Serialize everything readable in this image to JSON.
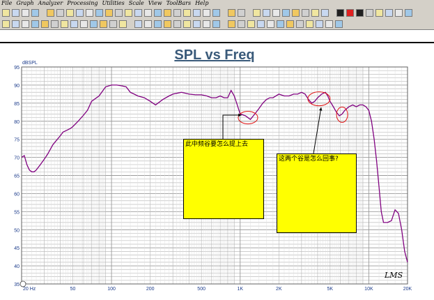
{
  "menu": {
    "items": [
      "File",
      "Graph",
      "Analyzer",
      "Processing",
      "Utilities",
      "Scale",
      "View",
      "ToolBars",
      "Help"
    ]
  },
  "toolbar": {
    "row1_icons": [
      "open-icon",
      "save-icon",
      "print-icon",
      "page-icon",
      "folder-icon",
      "folder-icon",
      "folder-icon",
      "folder-icon",
      "folder-icon",
      "folder-icon",
      "folder-icon",
      "folder-icon",
      "disk-icon",
      "disk-icon",
      "disk-icon",
      "disk-icon",
      "disk-icon",
      "disk-icon",
      "disk-icon",
      "disk-icon",
      "disk-icon",
      "disk-icon",
      "grid-icon",
      "grid-icon",
      "lasso-icon",
      "cursor-icon",
      "crop-icon",
      "crop-icon",
      "move-icon",
      "box-icon",
      "box-icon",
      "box-icon",
      "stop-icon",
      "record-icon",
      "stop-icon",
      "play-icon",
      "wand-icon",
      "tool-icon",
      "gear-icon",
      "mic-icon"
    ],
    "row2_icons": [
      "open-icon",
      "save-icon",
      "print-icon",
      "disk-icon",
      "disk-icon",
      "disk-icon",
      "disk-icon",
      "disk-icon",
      "disk-icon",
      "disk-icon",
      "disk-icon",
      "disk-icon",
      "disk-icon",
      "window-icon",
      "window-icon",
      "window-icon",
      "window-icon",
      "window-icon",
      "window-icon",
      "window-icon",
      "window-icon",
      "window-icon",
      "window-icon",
      "window-icon",
      "window-icon",
      "window-icon",
      "window-icon",
      "window-icon",
      "window-icon",
      "window-icon",
      "window-icon",
      "window-icon",
      "window-icon",
      "window-icon"
    ]
  },
  "chart_data": {
    "type": "line",
    "title": "SPL vs Freq",
    "ylabel": "dBSPL",
    "xlabel": "",
    "xscale": "log",
    "xlim": [
      20,
      20000
    ],
    "ylim": [
      35,
      95
    ],
    "grid": true,
    "legend": "none",
    "line_color": "#800080",
    "x_tick_labels": [
      {
        "value": 20,
        "label": "20 Hz"
      },
      {
        "value": 50,
        "label": "50"
      },
      {
        "value": 100,
        "label": "100"
      },
      {
        "value": 200,
        "label": "200"
      },
      {
        "value": 500,
        "label": "500"
      },
      {
        "value": 1000,
        "label": "1K"
      },
      {
        "value": 2000,
        "label": "2K"
      },
      {
        "value": 5000,
        "label": "5K"
      },
      {
        "value": 10000,
        "label": "10K"
      },
      {
        "value": 20000,
        "label": "20K"
      }
    ],
    "y_tick_labels": [
      "95",
      "90",
      "85",
      "80",
      "75",
      "70",
      "65",
      "60",
      "55",
      "50",
      "45",
      "40",
      "35"
    ],
    "series": [
      {
        "x": [
          20,
          21,
          22,
          23,
          24,
          25,
          26,
          28,
          30,
          32,
          35,
          40,
          42,
          45,
          48,
          50,
          55,
          60,
          65,
          70,
          80,
          90,
          100,
          105,
          110,
          120,
          130,
          140,
          150,
          160,
          180,
          200,
          220,
          250,
          280,
          300,
          350,
          400,
          450,
          500,
          550,
          600,
          650,
          700,
          750,
          800,
          850,
          900,
          950,
          1000,
          1100,
          1200,
          1300,
          1400,
          1500,
          1600,
          1700,
          1800,
          2000,
          2200,
          2400,
          2600,
          2800,
          3000,
          3200,
          3400,
          3600,
          3800,
          4000,
          4300,
          4600,
          4800,
          5000,
          5300,
          5600,
          5900,
          6200,
          6500,
          7000,
          7500,
          8000,
          8500,
          9000,
          9500,
          10000,
          10500,
          11000,
          11500,
          12000,
          12500,
          13000,
          14000,
          15000,
          16000,
          17000,
          18000,
          19000,
          20000
        ],
        "y": [
          70,
          70.5,
          68,
          66.5,
          66,
          66,
          66.5,
          68,
          69.5,
          71,
          73.5,
          76,
          77,
          77.5,
          78,
          78.5,
          80,
          81.5,
          83,
          85.5,
          87,
          89.5,
          90,
          90,
          90,
          89.8,
          89.5,
          88,
          87.5,
          87,
          86.5,
          85.5,
          84.5,
          86,
          87,
          87.5,
          88,
          87.5,
          87.3,
          87.3,
          87,
          86.5,
          86.5,
          87,
          86.5,
          86.5,
          88.5,
          87,
          84.5,
          82,
          81.5,
          80.5,
          82,
          83.5,
          85,
          86,
          86.5,
          86.5,
          87.5,
          87,
          87,
          87.5,
          87.5,
          88,
          87.5,
          86,
          85,
          85.5,
          86.5,
          87.5,
          88,
          87,
          85.5,
          84,
          82.5,
          81.5,
          82,
          83,
          84,
          84.5,
          84,
          84.5,
          84.5,
          84,
          83,
          80,
          75,
          69,
          62,
          55,
          52,
          52,
          52.5,
          55.5,
          54.5,
          50,
          44,
          41
        ]
      }
    ],
    "annotations": [
      {
        "text": "此中频谷要怎么提上去"
      },
      {
        "text": "这两个谷是怎么回事?"
      }
    ],
    "watermark": "LMS"
  }
}
